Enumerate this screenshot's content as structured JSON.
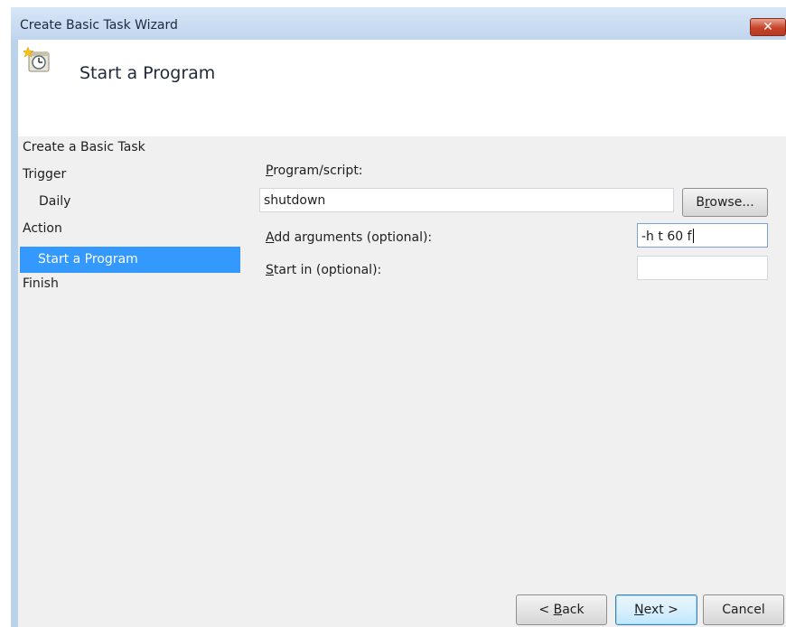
{
  "window": {
    "title": "Create Basic Task Wizard",
    "close_symbol": "✕"
  },
  "header": {
    "title": "Start a Program",
    "icon": "scheduled-task-icon"
  },
  "nav": {
    "items": [
      {
        "label": "Create a Basic Task"
      },
      {
        "label": "Trigger"
      },
      {
        "label": "Daily"
      },
      {
        "label": "Action"
      },
      {
        "label": "Start a Program",
        "selected": true
      },
      {
        "label": "Finish"
      }
    ]
  },
  "form": {
    "program_label_pre": "",
    "program_label_mn": "P",
    "program_label_post": "rogram/script:",
    "program_value": "shutdown",
    "browse_pre": "B",
    "browse_mn": "r",
    "browse_post": "owse...",
    "args_label_pre": "",
    "args_label_mn": "A",
    "args_label_post": "dd arguments (optional):",
    "args_value": "-h t 60 f",
    "startin_label_pre": "",
    "startin_label_mn": "S",
    "startin_label_post": "tart in (optional):",
    "startin_value": ""
  },
  "footer": {
    "back_pre": "< ",
    "back_mn": "B",
    "back_post": "ack",
    "next_pre": "",
    "next_mn": "N",
    "next_post": "ext >",
    "cancel_label": "Cancel"
  },
  "colors": {
    "selection": "#3399ff",
    "frame": "#bcd2ea",
    "close": "#c7432a"
  }
}
